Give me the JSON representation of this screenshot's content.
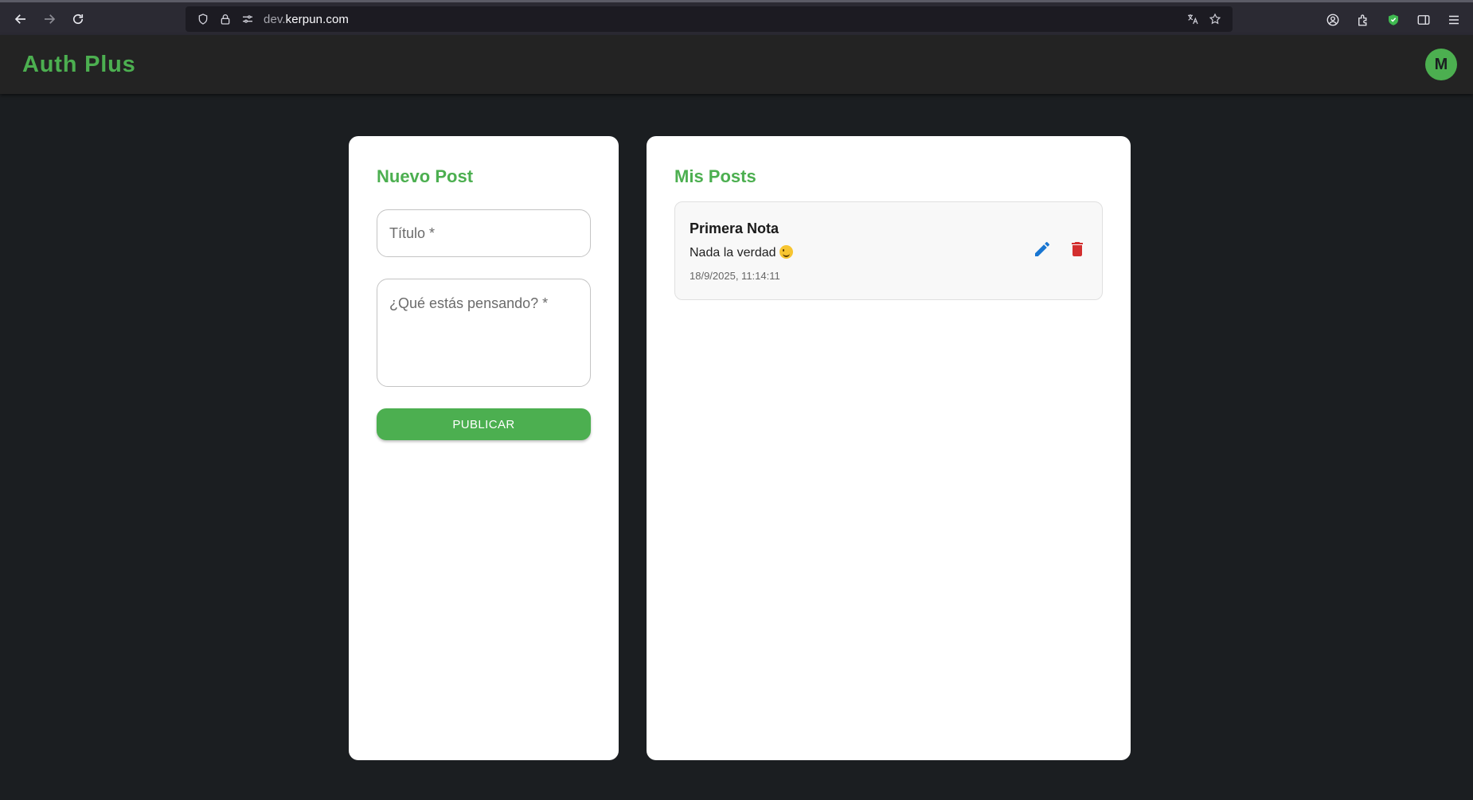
{
  "browser": {
    "url_prefix": "dev.",
    "url_domain": "kerpun.com"
  },
  "app": {
    "brand": "Auth Plus",
    "avatar_initial": "M"
  },
  "new_post": {
    "title": "Nuevo Post",
    "title_placeholder": "Título *",
    "body_placeholder": "¿Qué estás pensando? *",
    "title_value": "",
    "body_value": "",
    "publish_label": "PUBLICAR"
  },
  "my_posts": {
    "title": "Mis Posts",
    "items": [
      {
        "title": "Primera Nota",
        "body": "Nada la verdad",
        "emoji": "wink-emoji",
        "date": "18/9/2025, 11:14:11"
      }
    ]
  },
  "colors": {
    "accent": "#4caf50",
    "edit": "#1976d2",
    "delete": "#d32f2f",
    "page_bg": "#1b1e21"
  }
}
